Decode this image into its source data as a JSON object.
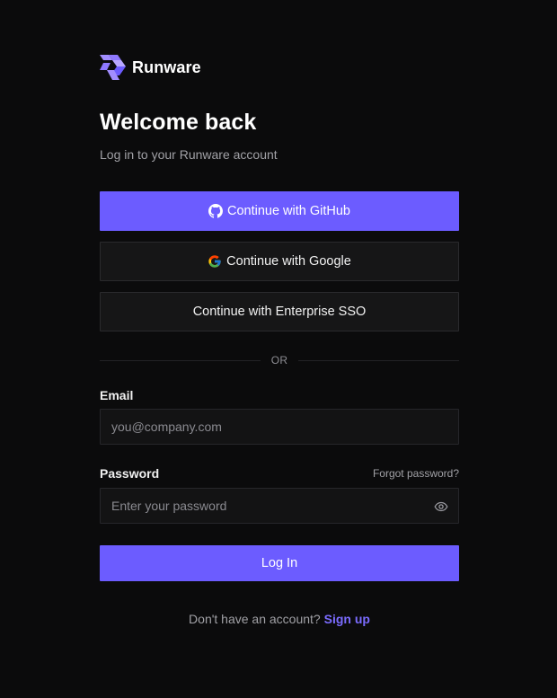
{
  "brand": {
    "name": "Runware",
    "logo_icon": "runware-logo-icon"
  },
  "header": {
    "title": "Welcome back",
    "subtitle": "Log in to your Runware account"
  },
  "oauth": {
    "github_label": "Continue with GitHub",
    "google_label": "Continue with Google",
    "sso_label": "Continue with Enterprise SSO"
  },
  "divider": {
    "text": "OR"
  },
  "form": {
    "email_label": "Email",
    "email_placeholder": "you@company.com",
    "email_value": "",
    "password_label": "Password",
    "password_placeholder": "Enter your password",
    "password_value": "",
    "forgot_label": "Forgot password?",
    "submit_label": "Log In"
  },
  "footer": {
    "prompt": "Don't have an account?",
    "signup_label": "Sign up"
  },
  "colors": {
    "background": "#0b0b0c",
    "accent": "#6c5cff",
    "link": "#7b6cff"
  }
}
